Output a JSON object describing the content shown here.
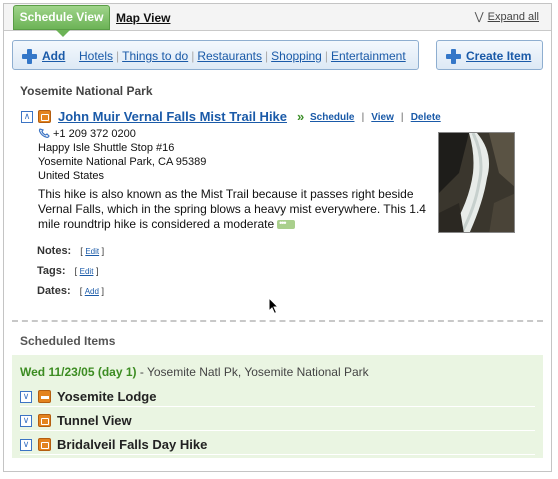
{
  "tabs": {
    "active": "Schedule View",
    "map": "Map View",
    "expand_all": "Expand all"
  },
  "toolbar": {
    "add_label": "Add",
    "categories": [
      "Hotels",
      "Things to do",
      "Restaurants",
      "Shopping",
      "Entertainment"
    ],
    "create_label": "Create Item"
  },
  "location": {
    "title": "Yosemite National Park"
  },
  "item": {
    "name": "John Muir Vernal Falls Mist Trail Hike",
    "raquo": "»",
    "actions": [
      "Schedule",
      "View",
      "Delete"
    ],
    "phone": "+1 209 372 0200",
    "address1": "Happy Isle Shuttle Stop #16",
    "address2": "Yosemite National Park, CA 95389",
    "country": "United States",
    "description": "This hike is also known as the Mist Trail because it passes right beside Vernal Falls, which in the spring blows a heavy mist everywhere. This 1.4 mile roundtrip hike is considered a moderate",
    "notes_label": "Notes:",
    "notes_link": "Edit",
    "tags_label": "Tags:",
    "tags_link": "Edit",
    "dates_label": "Dates:",
    "dates_link": "Add",
    "bracket_open": "[",
    "bracket_close": "]"
  },
  "scheduled": {
    "title": "Scheduled Items",
    "day": "Wed 11/23/05 (day 1)",
    "day_location": " - Yosemite Natl Pk, Yosemite National Park",
    "items": [
      {
        "name": "Yosemite Lodge",
        "icon": "bed-icon"
      },
      {
        "name": "Tunnel View",
        "icon": "camera-icon"
      },
      {
        "name": "Bridalveil Falls Day Hike",
        "icon": "camera-icon"
      }
    ]
  },
  "colors": {
    "tab_green": "#6cb356",
    "link_blue": "#1a5aa8",
    "scheduled_bg": "#eaf5e2",
    "day_green": "#3c8c22",
    "icon_orange": "#e3831f"
  }
}
